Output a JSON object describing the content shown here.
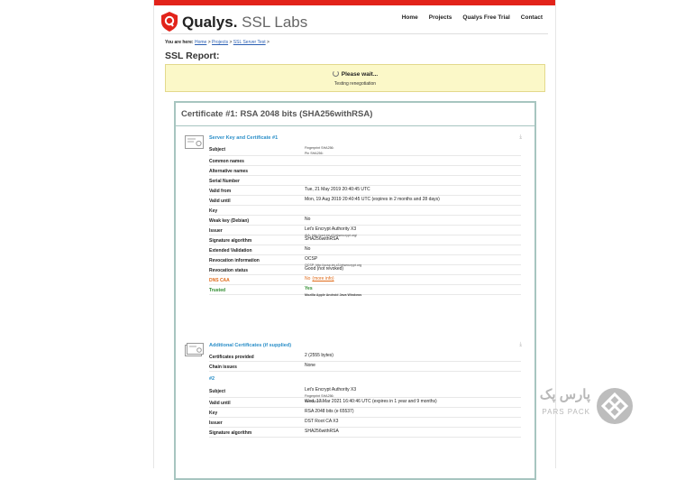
{
  "header": {
    "brand_name": "Qualys.",
    "brand_product": "SSL Labs",
    "nav": [
      "Home",
      "Projects",
      "Qualys Free Trial",
      "Contact"
    ]
  },
  "breadcrumb": {
    "prefix": "You are here:",
    "items": [
      "Home",
      "Projects",
      "SSL Server Test"
    ]
  },
  "page_title": "SSL Report:",
  "notice": {
    "title": "Please wait...",
    "message": "Testing renegotiation"
  },
  "certificate": {
    "heading": "Certificate #1: RSA 2048 bits (SHA256withRSA)",
    "server_key_title": "Server Key and Certificate #1",
    "rows": [
      {
        "key": "Subject",
        "value": "",
        "sub1": "Fingerprint SHA256:",
        "sub2": "Pin SHA256:"
      },
      {
        "key": "Common names",
        "value": ""
      },
      {
        "key": "Alternative names",
        "value": ""
      },
      {
        "key": "Serial Number",
        "value": ""
      },
      {
        "key": "Valid from",
        "value": "Tue, 21 May 2019 20:40:45 UTC"
      },
      {
        "key": "Valid until",
        "value": "Mon, 19 Aug 2019 20:40:45 UTC (expires in 2 months and 28 days)"
      },
      {
        "key": "Key",
        "value": ""
      },
      {
        "key": "Weak key (Debian)",
        "value": "No"
      },
      {
        "key": "Issuer",
        "value": "Let's Encrypt Authority X3",
        "sub1": "AIA: http://cert.int-x3.letsencrypt.org/"
      },
      {
        "key": "Signature algorithm",
        "value": "SHA256withRSA"
      },
      {
        "key": "Extended Validation",
        "value": "No"
      },
      {
        "key": "Revocation information",
        "value": "OCSP",
        "sub1": "OCSP: http://ocsp.int-x3.letsencrypt.org"
      },
      {
        "key": "Revocation status",
        "value": "Good (not revoked)"
      },
      {
        "key": "DNS CAA",
        "value": "No",
        "link": "(more info)"
      },
      {
        "key": "Trusted",
        "value": "Yes",
        "sub1": "Mozilla  Apple  Android  Java  Windows"
      }
    ],
    "additional_title": "Additional Certificates (if supplied)",
    "additional_rows": [
      {
        "key": "Certificates provided",
        "value": "2 (2555 bytes)"
      },
      {
        "key": "Chain issues",
        "value": "None"
      }
    ],
    "chain_label": "#2",
    "chain_rows": [
      {
        "key": "Subject",
        "value": "Let's Encrypt Authority X3",
        "sub1": "Fingerprint SHA256:",
        "sub2": "Pin SHA256:"
      },
      {
        "key": "Valid until",
        "value": "Wed, 17 Mar 2021 16:40:46 UTC (expires in 1 year and 9 months)"
      },
      {
        "key": "Key",
        "value": "RSA 2048 bits (e 65537)"
      },
      {
        "key": "Issuer",
        "value": "DST Root CA X3"
      },
      {
        "key": "Signature algorithm",
        "value": "SHA256withRSA"
      }
    ]
  },
  "watermark": {
    "text": "پارس پک",
    "latin": "PARS PACK"
  },
  "colors": {
    "accent_red": "#e2231a",
    "link_blue": "#2a8ec8",
    "notice_bg": "#fbf8c8"
  }
}
